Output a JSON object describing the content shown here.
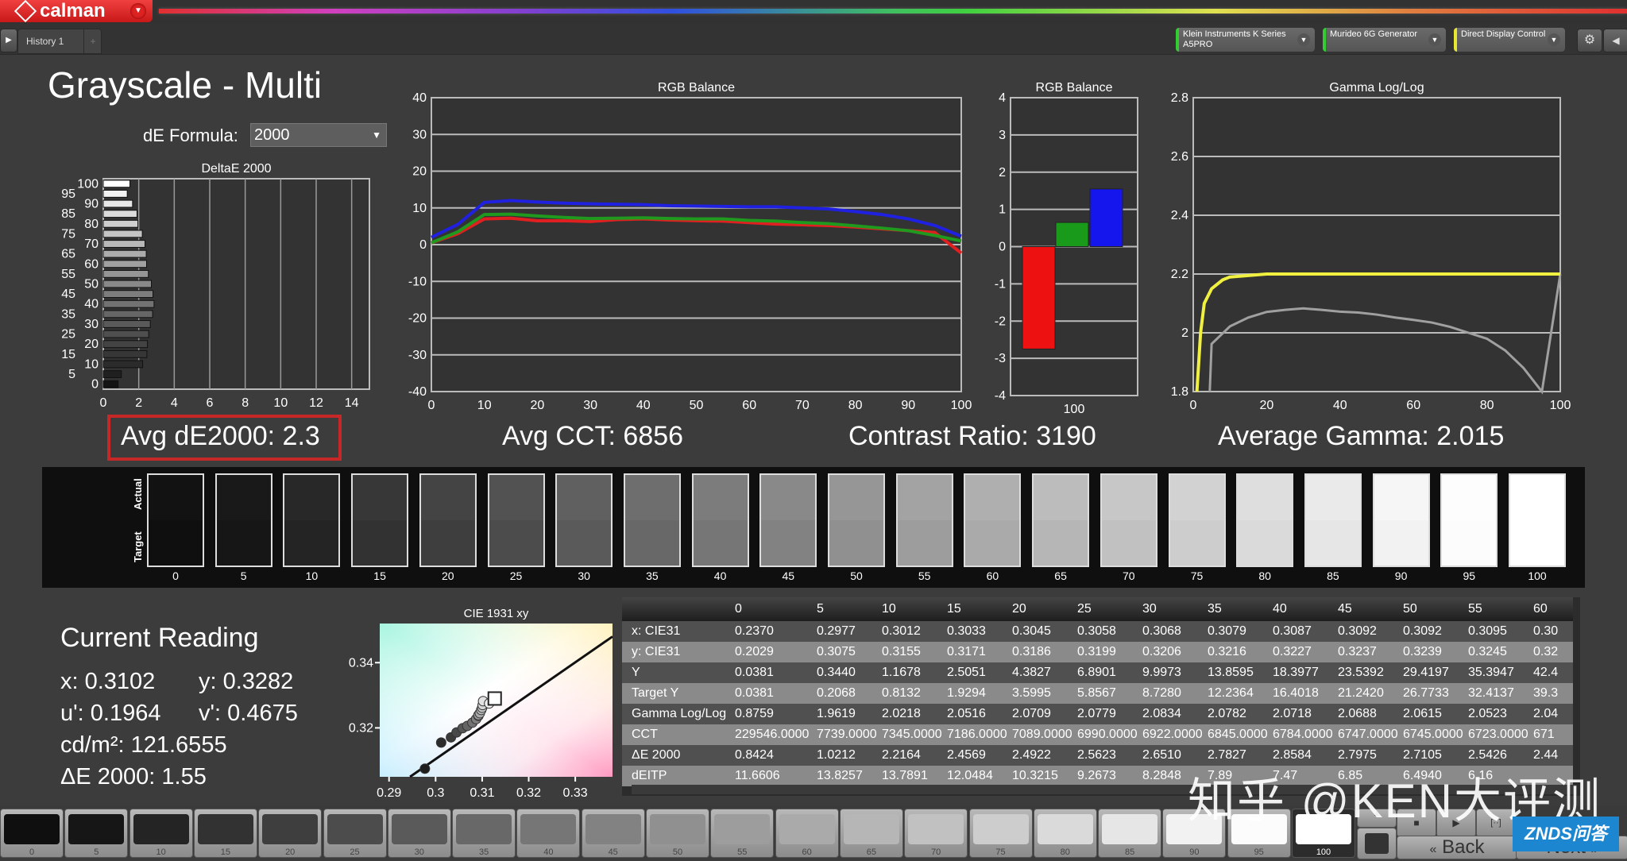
{
  "app": {
    "name": "calman",
    "tab": "History 1"
  },
  "devices": [
    {
      "label": "Klein Instruments K Series A5PRO",
      "status_color": "#33cc33"
    },
    {
      "label": "Murideo 6G Generator",
      "status_color": "#33cc33"
    },
    {
      "label": "Direct Display Control",
      "status_color": "#e6e633"
    }
  ],
  "page": {
    "title": "Grayscale - Multi",
    "de_formula_label": "dE Formula:",
    "de_formula_value": "2000"
  },
  "summary": {
    "avg_de": "Avg dE2000: 2.3",
    "avg_cct": "Avg CCT: 6856",
    "contrast": "Contrast Ratio: 3190",
    "avg_gamma": "Average Gamma: 2.015"
  },
  "swatch_strip": {
    "actual_label": "Actual",
    "target_label": "Target",
    "levels": [
      "0",
      "5",
      "10",
      "15",
      "20",
      "25",
      "30",
      "35",
      "40",
      "45",
      "50",
      "55",
      "60",
      "65",
      "70",
      "75",
      "80",
      "85",
      "90",
      "95",
      "100"
    ]
  },
  "current_reading": {
    "title": "Current Reading",
    "x": "x: 0.3102",
    "y": "y: 0.3282",
    "u": "u': 0.1964",
    "v": "v': 0.4675",
    "lum": "cd/m²: 121.6555",
    "de": "ΔE 2000: 1.55"
  },
  "table": {
    "columns": [
      "",
      "0",
      "5",
      "10",
      "15",
      "20",
      "25",
      "30",
      "35",
      "40",
      "45",
      "50",
      "55",
      "60"
    ],
    "rows": [
      {
        "label": "x: CIE31",
        "values": [
          "0.2370",
          "0.2977",
          "0.3012",
          "0.3033",
          "0.3045",
          "0.3058",
          "0.3068",
          "0.3079",
          "0.3087",
          "0.3092",
          "0.3092",
          "0.3095",
          "0.30"
        ]
      },
      {
        "label": "y: CIE31",
        "values": [
          "0.2029",
          "0.3075",
          "0.3155",
          "0.3171",
          "0.3186",
          "0.3199",
          "0.3206",
          "0.3216",
          "0.3227",
          "0.3237",
          "0.3239",
          "0.3245",
          "0.32"
        ]
      },
      {
        "label": "Y",
        "values": [
          "0.0381",
          "0.3440",
          "1.1678",
          "2.5051",
          "4.3827",
          "6.8901",
          "9.9973",
          "13.8595",
          "18.3977",
          "23.5392",
          "29.4197",
          "35.3947",
          "42.4"
        ]
      },
      {
        "label": "Target Y",
        "values": [
          "0.0381",
          "0.2068",
          "0.8132",
          "1.9294",
          "3.5995",
          "5.8567",
          "8.7280",
          "12.2364",
          "16.4018",
          "21.2420",
          "26.7733",
          "32.4137",
          "39.3"
        ]
      },
      {
        "label": "Gamma Log/Log",
        "values": [
          "0.8759",
          "1.9619",
          "2.0218",
          "2.0516",
          "2.0709",
          "2.0779",
          "2.0834",
          "2.0782",
          "2.0718",
          "2.0688",
          "2.0615",
          "2.0523",
          "2.04"
        ]
      },
      {
        "label": "CCT",
        "values": [
          "229546.0000",
          "7739.0000",
          "7345.0000",
          "7186.0000",
          "7089.0000",
          "6990.0000",
          "6922.0000",
          "6845.0000",
          "6784.0000",
          "6747.0000",
          "6745.0000",
          "6723.0000",
          "671"
        ]
      },
      {
        "label": "ΔE 2000",
        "values": [
          "0.8424",
          "1.0212",
          "2.2164",
          "2.4569",
          "2.4922",
          "2.5623",
          "2.6510",
          "2.7827",
          "2.8584",
          "2.7975",
          "2.7105",
          "2.5426",
          "2.44"
        ]
      },
      {
        "label": "dEITP",
        "values": [
          "11.6606",
          "13.8257",
          "13.7891",
          "12.0484",
          "10.3215",
          "9.2673",
          "8.2848",
          "7.89",
          "7.47",
          "6.85",
          "6.4940",
          "6.16",
          ""
        ]
      }
    ]
  },
  "controls": {
    "back": "Back",
    "next": "Next"
  },
  "watermark": {
    "text": "知乎 @KEN大评测",
    "badge": "ZNDS问答"
  },
  "chart_data": [
    {
      "type": "bar",
      "title": "DeltaE 2000",
      "orientation": "horizontal",
      "categories": [
        "0",
        "5",
        "10",
        "15",
        "20",
        "25",
        "30",
        "35",
        "40",
        "45",
        "50",
        "55",
        "60",
        "65",
        "70",
        "75",
        "80",
        "85",
        "90",
        "95",
        "100"
      ],
      "values": [
        0.84,
        1.02,
        2.22,
        2.46,
        2.49,
        2.56,
        2.65,
        2.78,
        2.86,
        2.8,
        2.71,
        2.54,
        2.44,
        2.42,
        2.35,
        2.2,
        1.95,
        1.9,
        1.65,
        1.35,
        1.5
      ],
      "xlim": [
        0,
        15
      ],
      "xticks": [
        "0",
        "2",
        "4",
        "6",
        "8",
        "10",
        "12",
        "14"
      ],
      "yticks": [
        "0",
        "5",
        "10",
        "15",
        "20",
        "25",
        "30",
        "35",
        "40",
        "45",
        "50",
        "55",
        "60",
        "65",
        "70",
        "75",
        "80",
        "85",
        "90",
        "95",
        "100"
      ]
    },
    {
      "type": "line",
      "title": "RGB Balance",
      "x": [
        0,
        5,
        10,
        15,
        20,
        25,
        30,
        35,
        40,
        45,
        50,
        55,
        60,
        65,
        70,
        75,
        80,
        85,
        90,
        95,
        100
      ],
      "series": [
        {
          "name": "Red",
          "color": "#e02020",
          "values": [
            0.5,
            3,
            7,
            7.2,
            6.5,
            6.5,
            6.3,
            6.8,
            7,
            6.7,
            6.5,
            6.4,
            6,
            5.6,
            5.4,
            5.2,
            4.8,
            4.3,
            3.8,
            3.3,
            -2.3
          ]
        },
        {
          "name": "Green",
          "color": "#1f9a1f",
          "values": [
            0.5,
            3.5,
            8.2,
            8.3,
            7.8,
            7.4,
            7.1,
            7.2,
            7.3,
            7.1,
            7,
            7,
            6.6,
            6.4,
            6,
            5.7,
            5.1,
            4.5,
            3.8,
            2.5,
            1
          ]
        },
        {
          "name": "Blue",
          "color": "#2020e0",
          "values": [
            2,
            5.5,
            11.5,
            12,
            11.6,
            11.3,
            11.1,
            11,
            10.9,
            10.6,
            10.5,
            10.4,
            10.3,
            10.3,
            10,
            9.7,
            9,
            8.2,
            7,
            5.2,
            2.3
          ]
        }
      ],
      "ylim": [
        -40,
        40
      ],
      "yticks": [
        "-40",
        "-30",
        "-20",
        "-10",
        "0",
        "10",
        "20",
        "30",
        "40"
      ],
      "xticks": [
        "0",
        "10",
        "20",
        "30",
        "40",
        "50",
        "60",
        "70",
        "80",
        "90",
        "100"
      ]
    },
    {
      "type": "bar",
      "title": "RGB Balance",
      "categories": [
        "100"
      ],
      "series": [
        {
          "name": "Red",
          "color": "#ee1111",
          "values": [
            -2.75
          ]
        },
        {
          "name": "Green",
          "color": "#1a9a1a",
          "values": [
            0.65
          ]
        },
        {
          "name": "Blue",
          "color": "#1515ee",
          "values": [
            1.55
          ]
        }
      ],
      "ylim": [
        -4,
        4
      ],
      "yticks": [
        "-4",
        "-3",
        "-2",
        "-1",
        "0",
        "1",
        "2",
        "3",
        "4"
      ]
    },
    {
      "type": "line",
      "title": "Gamma Log/Log",
      "x": [
        1,
        2,
        3,
        5,
        8,
        10,
        15,
        20,
        30,
        40,
        50,
        60,
        70,
        80,
        90,
        95,
        100
      ],
      "series": [
        {
          "name": "Target",
          "color": "#f0f040",
          "values": [
            1.8,
            2.0,
            2.1,
            2.15,
            2.18,
            2.19,
            2.195,
            2.2,
            2.2,
            2.2,
            2.2,
            2.2,
            2.2,
            2.2,
            2.2,
            2.2,
            2.2
          ]
        }
      ],
      "measured": {
        "name": "Measured",
        "color": "#a0a0a0",
        "x": [
          5,
          10,
          15,
          20,
          25,
          30,
          35,
          40,
          45,
          50,
          55,
          60,
          65,
          70,
          75,
          80,
          85,
          90,
          95,
          100
        ],
        "values": [
          1.962,
          2.022,
          2.052,
          2.071,
          2.078,
          2.083,
          2.078,
          2.072,
          2.069,
          2.062,
          2.052,
          2.044,
          2.035,
          2.02,
          2.0,
          1.98,
          1.94,
          1.88,
          1.78,
          2.2
        ]
      },
      "ylim": [
        1.8,
        2.8
      ],
      "xlim": [
        0,
        100
      ],
      "yticks": [
        "1.8",
        "2",
        "2.2",
        "2.4",
        "2.6",
        "2.8"
      ],
      "xticks": [
        "0",
        "20",
        "40",
        "60",
        "80",
        "100"
      ]
    },
    {
      "type": "scatter",
      "title": "CIE 1931 xy",
      "points": [
        [
          0.2977,
          0.3075
        ],
        [
          0.3012,
          0.3155
        ],
        [
          0.3033,
          0.3171
        ],
        [
          0.3045,
          0.3186
        ],
        [
          0.3058,
          0.3199
        ],
        [
          0.3068,
          0.3206
        ],
        [
          0.3079,
          0.3216
        ],
        [
          0.3087,
          0.3227
        ],
        [
          0.3092,
          0.3237
        ],
        [
          0.3092,
          0.3239
        ],
        [
          0.3095,
          0.3245
        ],
        [
          0.3098,
          0.3255
        ],
        [
          0.31,
          0.3262
        ],
        [
          0.3101,
          0.327
        ],
        [
          0.3102,
          0.3282
        ],
        [
          0.3115,
          0.3275
        ]
      ],
      "target": [
        0.3127,
        0.329
      ],
      "xlim": [
        0.288,
        0.338
      ],
      "ylim": [
        0.305,
        0.352
      ],
      "xticks": [
        "0.29",
        "0.3",
        "0.31",
        "0.32",
        "0.33"
      ],
      "yticks": [
        "0.32",
        "0.34"
      ]
    }
  ]
}
